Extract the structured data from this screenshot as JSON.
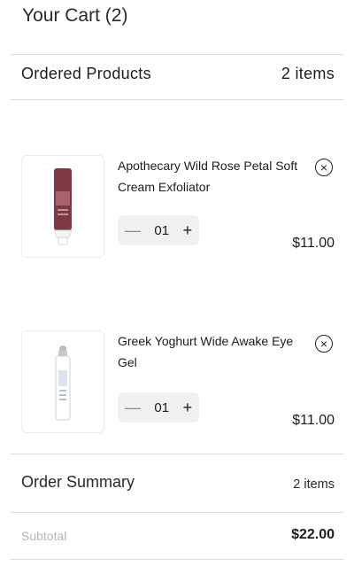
{
  "cart": {
    "title": "Your Cart (2)"
  },
  "ordered": {
    "label": "Ordered Products",
    "count": "2 items"
  },
  "items": [
    {
      "name": "Apothecary Wild Rose Petal Soft Cream Exfoliator",
      "qty": "01",
      "price": "$11.00",
      "decrement": "—",
      "increment": "+",
      "remove": "×"
    },
    {
      "name": "Greek Yoghurt Wide Awake Eye Gel",
      "qty": "01",
      "price": "$11.00",
      "decrement": "—",
      "increment": "+",
      "remove": "×"
    }
  ],
  "summary": {
    "label": "Order Summary",
    "count": "2 items"
  },
  "subtotal": {
    "label": "Subtotal",
    "value": "$22.00"
  },
  "colors": {
    "divider": "#dcdcdc",
    "stepper_bg": "#f1f1f1",
    "rose_tube": "#7d3a45"
  },
  "icons": {
    "remove": "close-circle-icon",
    "product1": "cream-tube-image",
    "product2": "roller-bottle-image"
  }
}
